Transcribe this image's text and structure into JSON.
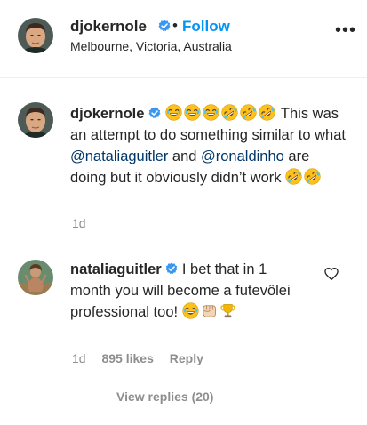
{
  "header": {
    "username": "djokernole",
    "dot": "•",
    "follow_label": "Follow",
    "location": "Melbourne, Victoria, Australia",
    "more_label": "•••"
  },
  "comment1": {
    "username": "djokernole",
    "text_a": " This was an attempt to do something similar to what ",
    "mention_a": "@nataliaguitler",
    "text_b": " and ",
    "mention_b": "@ronaldinho",
    "text_c": " are doing but it obviously didn’t work ",
    "time": "1d"
  },
  "comment2": {
    "username": "nataliaguitler",
    "text": " I bet that in 1 month you will become a futevôlei professional too! ",
    "time": "1d",
    "likes": "895 likes",
    "reply_label": "Reply"
  },
  "view_replies": "View replies (20)",
  "colors": {
    "link": "#0095f6",
    "mention": "#00376b",
    "muted": "#8e8e8e",
    "text": "#262626",
    "verified": "#3897f0"
  }
}
